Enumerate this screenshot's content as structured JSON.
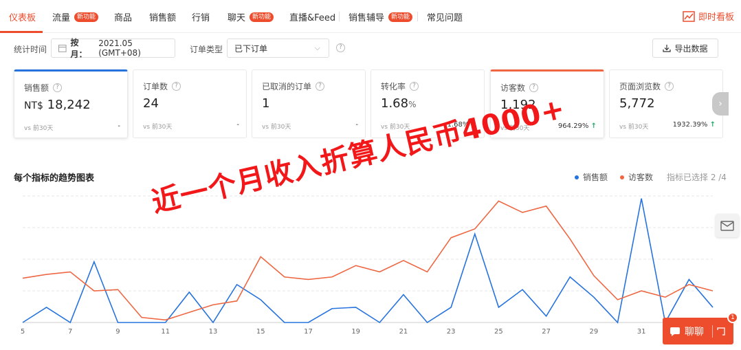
{
  "nav": {
    "items": [
      {
        "label": "仪表板",
        "active": true
      },
      {
        "label": "流量",
        "badge": "新功能"
      },
      {
        "label": "商品"
      },
      {
        "label": "销售额"
      },
      {
        "label": "行销"
      },
      {
        "label": "聊天",
        "badge": "新功能"
      },
      {
        "label": "直播&Feed"
      },
      {
        "label": "销售辅导",
        "badge": "新功能"
      },
      {
        "label": "常见问题"
      }
    ],
    "realtime": "即时看板"
  },
  "filter": {
    "period_label": "统计时间",
    "date_mode": "按月：",
    "date_value": "2021.05 (GMT+08)",
    "order_type_label": "订单类型",
    "order_type_value": "已下订单",
    "export": "导出数据"
  },
  "cards": [
    {
      "title": "销售额",
      "prefix": "NT$",
      "value": "18,242",
      "vs": "vs 前30天",
      "change": "-"
    },
    {
      "title": "订单数",
      "value": "24",
      "vs": "vs 前30天",
      "change": "-"
    },
    {
      "title": "已取消的订单",
      "value": "1",
      "vs": "vs 前30天",
      "change": "-"
    },
    {
      "title": "转化率",
      "value": "1.68",
      "suffix": "%",
      "vs": "vs 前30天",
      "change": "1.68%",
      "trend": "up"
    },
    {
      "title": "访客数",
      "value": "1,192",
      "vs": "vs 前30天",
      "change": "964.29%",
      "trend": "up"
    },
    {
      "title": "页面浏览数",
      "value": "5,772",
      "vs": "vs 前30天",
      "change": "1932.39%",
      "trend": "up"
    }
  ],
  "chart": {
    "title": "每个指标的趋势图表",
    "legend_sales": "销售额",
    "legend_visitors": "访客数",
    "selected": "指标已选择 2 /4"
  },
  "overlay_text": "近一个月收入折算人民币4000+",
  "chat": {
    "label": "聊聊",
    "badge": "1"
  },
  "colors": {
    "accent": "#ee4d2d",
    "sales": "#2673dd",
    "visitors": "#ee6742",
    "up": "#26aa66"
  },
  "chart_data": {
    "type": "line",
    "x": [
      5,
      6,
      7,
      8,
      9,
      10,
      11,
      12,
      13,
      14,
      15,
      16,
      17,
      18,
      19,
      20,
      21,
      22,
      23,
      24,
      25,
      26,
      27,
      28,
      29,
      30,
      31,
      32,
      33,
      34
    ],
    "x_ticks": [
      "5",
      "7",
      "9",
      "11",
      "13",
      "15",
      "17",
      "19",
      "21",
      "23",
      "25",
      "27",
      "29",
      "31"
    ],
    "ylim": [
      0,
      100
    ],
    "series": [
      {
        "name": "销售额",
        "color": "#2673dd",
        "values": [
          0,
          12,
          0,
          48,
          0,
          0,
          0,
          24,
          0,
          30,
          18,
          0,
          0,
          11,
          12,
          0,
          22,
          0,
          12,
          70,
          12,
          26,
          5,
          36,
          20,
          0,
          98,
          0,
          34,
          12
        ]
      },
      {
        "name": "访客数",
        "color": "#ee6742",
        "values": [
          35,
          38,
          40,
          25,
          26,
          4,
          2,
          8,
          14,
          17,
          52,
          36,
          34,
          36,
          45,
          40,
          49,
          40,
          67,
          74,
          96,
          87,
          92,
          66,
          37,
          18,
          25,
          20,
          30,
          25
        ]
      }
    ]
  }
}
